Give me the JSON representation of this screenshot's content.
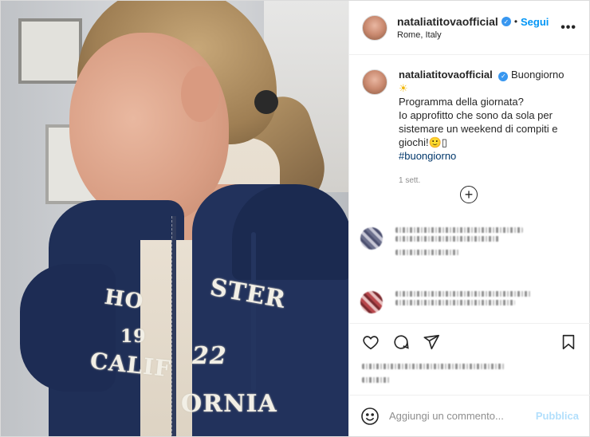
{
  "header": {
    "username": "nataliatitovaofficial",
    "follow_label": "Segui",
    "dot": "•",
    "location": "Rome, Italy",
    "more_label": "•••"
  },
  "caption": {
    "username": "nataliatitovaofficial",
    "line1": "Buongiorno",
    "line2": "Programma della giornata?",
    "line3": "Io approfitto che sono da sola per sistemare un weekend di compiti e giochi!",
    "emoji_tail": "🙂▯",
    "hashtag": "#buongiorno",
    "time": "1 sett."
  },
  "photo": {
    "logo_lines": [
      "HO",
      "STER",
      "19",
      "22",
      "CALIF",
      "ORNIA"
    ]
  },
  "add_comment": {
    "placeholder": "Aggiungi un commento...",
    "publish_label": "Pubblica"
  },
  "icons": {
    "verified": "verified-badge-icon",
    "sun": "sun-emoji-icon",
    "load_more": "plus-circle-icon",
    "like": "heart-icon",
    "comment": "comment-bubble-icon",
    "share": "paper-plane-icon",
    "save": "bookmark-icon",
    "emoji": "smiley-icon"
  },
  "colors": {
    "link_blue": "#0095f6",
    "publish_disabled": "#b2dffc",
    "verified_blue": "#3897f0",
    "hashtag": "#00376b"
  }
}
